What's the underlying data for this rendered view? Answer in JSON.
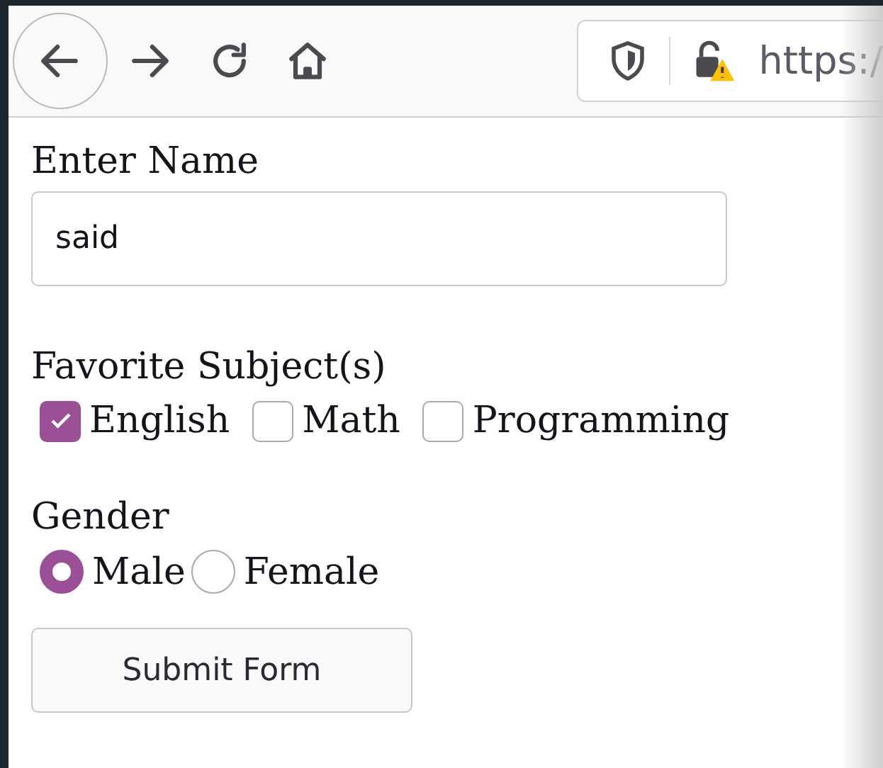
{
  "toolbar": {
    "url": "https:/"
  },
  "name_field": {
    "label": "Enter Name",
    "value": "said"
  },
  "subjects": {
    "label": "Favorite Subject(s)",
    "options": [
      {
        "label": "English",
        "checked": true
      },
      {
        "label": "Math",
        "checked": false
      },
      {
        "label": "Programming",
        "checked": false
      }
    ]
  },
  "gender": {
    "label": "Gender",
    "options": [
      {
        "label": "Male",
        "selected": true
      },
      {
        "label": "Female",
        "selected": false
      }
    ]
  },
  "submit_button": "Submit Form"
}
